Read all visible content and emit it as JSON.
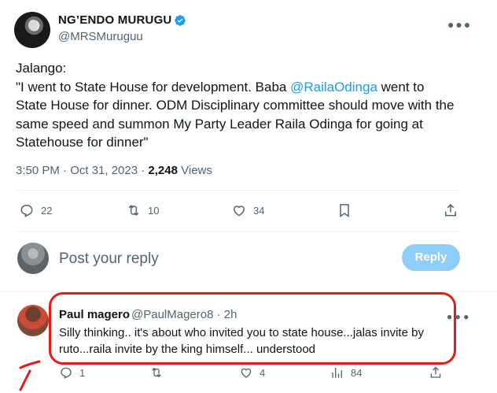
{
  "tweet": {
    "display_name": "NG’ENDO MURUGU",
    "handle": "@MRSMuruguu",
    "text_before_mention": "Jalango:\n\"I went to State House for development. Baba ",
    "mention": "@RailaOdinga",
    "text_after_mention": " went to State House for dinner. ODM Disciplinary committee should move with the same speed and summon My Party Leader Raila Odinga for going at Statehouse for dinner\"",
    "time": "3:50 PM · Oct 31, 2023 · ",
    "views_count": "2,248",
    "views_label": " Views",
    "stats": {
      "replies": "22",
      "reposts": "10",
      "likes": "34"
    }
  },
  "reply_composer": {
    "placeholder": "Post your reply",
    "button_label": "Reply"
  },
  "reply": {
    "display_name": "Paul magero",
    "handle_time": "@PaulMagero8 · 2h",
    "text": "Silly thinking.. it's about who invited you to state house...jalas invite by ruto...raila invite by the king himself... understood",
    "stats": {
      "replies": "1",
      "reposts": "",
      "likes": "4",
      "views": "84"
    }
  },
  "colors": {
    "accent": "#1d9bf0",
    "muted": "#536471",
    "highlight_red": "#e21b1b",
    "reply_button_disabled": "#8ecdf8"
  },
  "icons": [
    "verified-badge-icon",
    "more-icon",
    "reply-icon",
    "repost-icon",
    "like-icon",
    "bookmark-icon",
    "share-icon",
    "views-icon"
  ]
}
